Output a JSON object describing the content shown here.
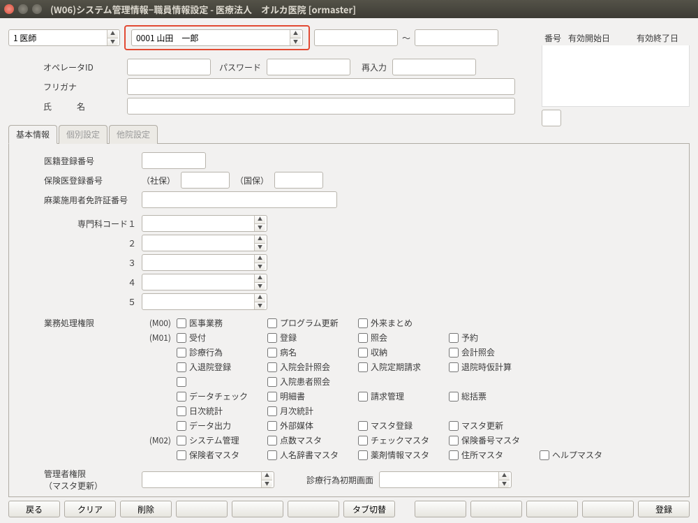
{
  "titlebar": {
    "title": "(W06)システム管理情報−職員情報設定 - 医療法人　オルカ医院  [ormaster]"
  },
  "top": {
    "role_value": "1 医師",
    "staff_value": "0001 山田　一郎",
    "range_sep": "～",
    "side_cols": {
      "no": "番号",
      "start": "有効開始日",
      "end": "有効終了日"
    }
  },
  "upper": {
    "operator_id_label": "オペレータID",
    "password_label": "パスワード",
    "reenter_label": "再入力",
    "furigana_label": "フリガナ",
    "name_label": "氏　　　名"
  },
  "tabs": {
    "basic": "基本情報",
    "indiv": "個別設定",
    "other": "他院設定"
  },
  "basic": {
    "med_reg_no": "医籍登録番号",
    "ins_reg_no": "保険医登録番号",
    "shaho": "（社保）",
    "kokuho": "（国保）",
    "narc_license": "麻薬施用者免許証番号",
    "spec_code": "専門科コード１",
    "n2": "２",
    "n3": "３",
    "n4": "４",
    "n5": "５",
    "perm_label": "業務処理権限",
    "m00": "(M00)",
    "m01": "(M01)",
    "m02": "(M02)",
    "chk": {
      "iji": "医事業務",
      "prog": "プログラム更新",
      "gairai": "外来まとめ",
      "uketsuke": "受付",
      "touroku": "登録",
      "shoukai": "照会",
      "yoyaku": "予約",
      "shinryo": "診療行為",
      "byoumei": "病名",
      "shuunou": "収納",
      "kaikei_shoukai": "会計照会",
      "nyutaiin": "入退院登録",
      "nyuin_kaikei": "入院会計照会",
      "nyuin_teiki": "入院定期請求",
      "taiin_kari": "退院時仮計算",
      "nyuin_kanja": "入院患者照会",
      "data_check": "データチェック",
      "meisai": "明細書",
      "seikyu": "請求管理",
      "soukatsu": "総括票",
      "nichiji": "日次統計",
      "getsuji": "月次統計",
      "data_out": "データ出力",
      "gaibu": "外部媒体",
      "master_touroku": "マスタ登録",
      "master_koushin": "マスタ更新",
      "system": "システム管理",
      "tensuu": "点数マスタ",
      "check_master": "チェックマスタ",
      "hoken_bangou": "保険番号マスタ",
      "hokensha": "保険者マスタ",
      "jinmei": "人名辞書マスタ",
      "yakuzai": "薬剤情報マスタ",
      "jusho": "住所マスタ",
      "help": "ヘルプマスタ"
    },
    "admin_perm": "管理者権限",
    "admin_sub": "（マスタ更新）",
    "initial_screen": "診療行為初期画面"
  },
  "footer": {
    "back": "戻る",
    "clear": "クリア",
    "delete": "削除",
    "tab_switch": "タブ切替",
    "register": "登録"
  }
}
